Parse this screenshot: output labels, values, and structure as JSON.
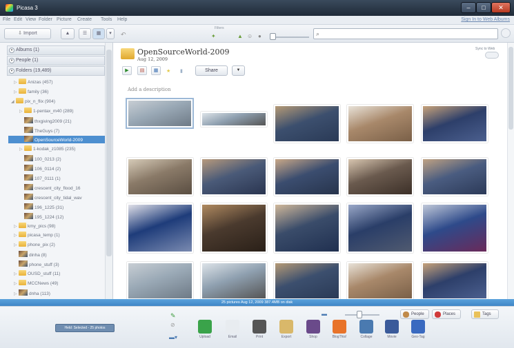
{
  "window": {
    "title": "Picasa 3"
  },
  "menu": [
    "File",
    "Edit",
    "View",
    "Folder",
    "Picture",
    "Create",
    "Tools",
    "Help"
  ],
  "sign_in": "Sign In to Web Albums",
  "toolbar": {
    "import": "Import",
    "filters_label": "Filters"
  },
  "sidebar": {
    "sections": [
      {
        "label": "Albums (1)"
      },
      {
        "label": "People (1)"
      },
      {
        "label": "Folders (19,489)"
      }
    ],
    "folders": [
      {
        "label": "Anizas (457)",
        "type": "folder",
        "expand": "▷"
      },
      {
        "label": "family (36)",
        "type": "folder",
        "expand": "▷"
      },
      {
        "label": "pix_n_flix (904)",
        "type": "folder",
        "expand": "◢"
      },
      {
        "label": "1-pentax_m40 (289)",
        "type": "folder",
        "expand": "▷"
      },
      {
        "label": "thxgiving2009 (21)",
        "type": "photo",
        "expand": ""
      },
      {
        "label": "TheGuys (7)",
        "type": "photo",
        "expand": ""
      },
      {
        "label": "OpenSourceWorld-2009",
        "type": "photo",
        "expand": "",
        "selected": true
      },
      {
        "label": "1-kodak_z1085 (235)",
        "type": "folder",
        "expand": "▷"
      },
      {
        "label": "100_0213 (2)",
        "type": "photo",
        "expand": ""
      },
      {
        "label": "106_0114 (2)",
        "type": "photo",
        "expand": ""
      },
      {
        "label": "107_0111 (1)",
        "type": "photo",
        "expand": ""
      },
      {
        "label": "crescent_city_flood_16",
        "type": "photo",
        "expand": ""
      },
      {
        "label": "crescent_city_tidal_wav",
        "type": "photo",
        "expand": ""
      },
      {
        "label": "196_1225 (31)",
        "type": "photo",
        "expand": ""
      },
      {
        "label": "195_1224 (12)",
        "type": "photo",
        "expand": ""
      },
      {
        "label": "kmy_pics (98)",
        "type": "folder",
        "expand": "▷"
      },
      {
        "label": "picasa_temp (1)",
        "type": "folder",
        "expand": "▷"
      },
      {
        "label": "phone_pix (2)",
        "type": "folder",
        "expand": "▷"
      },
      {
        "label": "dinha (8)",
        "type": "photo",
        "expand": ""
      },
      {
        "label": "phone_stuff (3)",
        "type": "photo",
        "expand": ""
      },
      {
        "label": "OUSD_stuff (11)",
        "type": "folder",
        "expand": "▷"
      },
      {
        "label": "MCCNews (49)",
        "type": "folder",
        "expand": "▷"
      },
      {
        "label": "dnha (113)",
        "type": "photo",
        "expand": "▷"
      }
    ]
  },
  "album": {
    "title": "OpenSourceWorld-2009",
    "date": "Aug 12, 2009",
    "sync_label": "Sync to Web",
    "share": "Share",
    "description_placeholder": "Add a description"
  },
  "status": "25 pictures    Aug 12, 2009    387.4MB on disk",
  "tray": {
    "held": "Held: Selected - 25 photos",
    "actions": [
      "Upload",
      "Email",
      "Print",
      "Export",
      "Shop",
      "BlogThis!",
      "Collage",
      "Movie",
      "Geo-Tag"
    ],
    "tag_buttons": [
      "People",
      "Places",
      "Tags"
    ]
  },
  "colors": {
    "accent": "#4d8fd0",
    "statusbar": "#4a92d0",
    "titlebar": "#2b3747"
  }
}
